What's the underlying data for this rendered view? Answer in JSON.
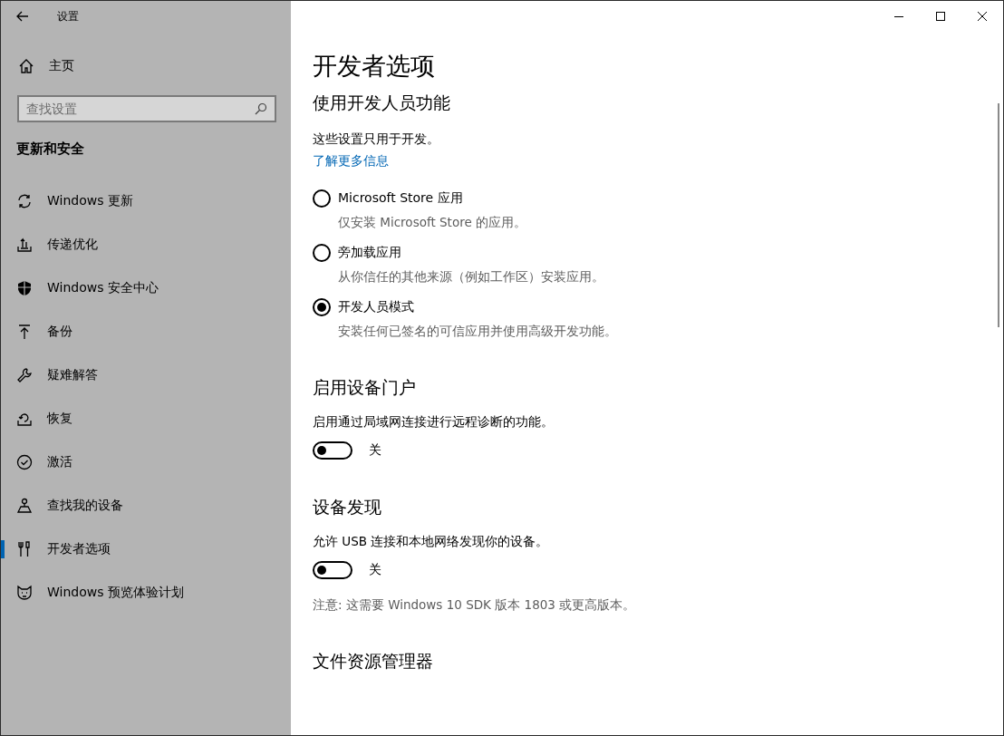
{
  "window": {
    "title": "设置"
  },
  "sidebar": {
    "home": "主页",
    "search": {
      "placeholder": "查找设置"
    },
    "group_title": "更新和安全",
    "items": [
      {
        "label": "Windows 更新",
        "selected": false
      },
      {
        "label": "传递优化",
        "selected": false
      },
      {
        "label": "Windows 安全中心",
        "selected": false
      },
      {
        "label": "备份",
        "selected": false
      },
      {
        "label": "疑难解答",
        "selected": false
      },
      {
        "label": "恢复",
        "selected": false
      },
      {
        "label": "激活",
        "selected": false
      },
      {
        "label": "查找我的设备",
        "selected": false
      },
      {
        "label": "开发者选项",
        "selected": true
      },
      {
        "label": "Windows 预览体验计划",
        "selected": false
      }
    ]
  },
  "page": {
    "title": "开发者选项",
    "sections": [
      {
        "heading": "使用开发人员功能",
        "description": "这些设置只用于开发。",
        "link": "了解更多信息",
        "options": [
          {
            "label": "Microsoft Store 应用",
            "description": "仅安装 Microsoft Store 的应用。",
            "selected": false
          },
          {
            "label": "旁加载应用",
            "description": "从你信任的其他来源（例如工作区）安装应用。",
            "selected": false
          },
          {
            "label": "开发人员模式",
            "description": "安装任何已签名的可信应用并使用高级开发功能。",
            "selected": true
          }
        ]
      },
      {
        "heading": "启用设备门户",
        "description": "启用通过局域网连接进行远程诊断的功能。",
        "toggle": {
          "on": false,
          "label": "关"
        }
      },
      {
        "heading": "设备发现",
        "description": "允许 USB 连接和本地网络发现你的设备。",
        "toggle": {
          "on": false,
          "label": "关"
        },
        "note": "注意: 这需要 Windows 10 SDK 版本 1803 或更高版本。"
      },
      {
        "heading": "文件资源管理器"
      }
    ]
  }
}
